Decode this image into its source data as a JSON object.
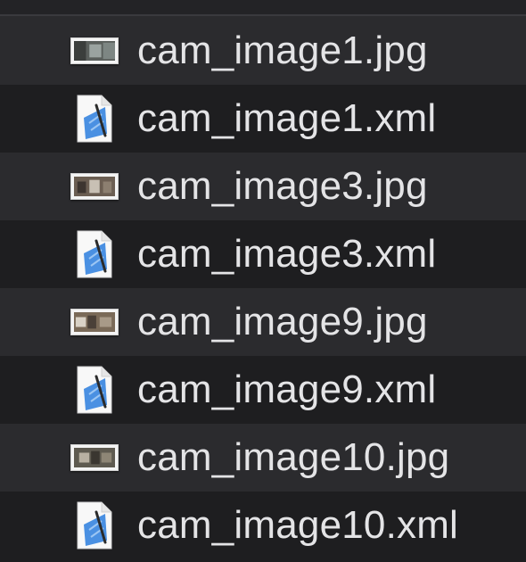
{
  "files": [
    {
      "name": "cam_image1.jpg",
      "icon": "jpg-thumbnail-icon",
      "type": "jpg"
    },
    {
      "name": "cam_image1.xml",
      "icon": "xml-document-icon",
      "type": "xml"
    },
    {
      "name": "cam_image3.jpg",
      "icon": "jpg-thumbnail-icon",
      "type": "jpg"
    },
    {
      "name": "cam_image3.xml",
      "icon": "xml-document-icon",
      "type": "xml"
    },
    {
      "name": "cam_image9.jpg",
      "icon": "jpg-thumbnail-icon",
      "type": "jpg"
    },
    {
      "name": "cam_image9.xml",
      "icon": "xml-document-icon",
      "type": "xml"
    },
    {
      "name": "cam_image10.jpg",
      "icon": "jpg-thumbnail-icon",
      "type": "jpg"
    },
    {
      "name": "cam_image10.xml",
      "icon": "xml-document-icon",
      "type": "xml"
    }
  ],
  "colors": {
    "background": "#1e1e20",
    "alternate_row": "#2b2b2e",
    "text": "#e4e4e6",
    "xml_icon_blue": "#4a90e2"
  }
}
